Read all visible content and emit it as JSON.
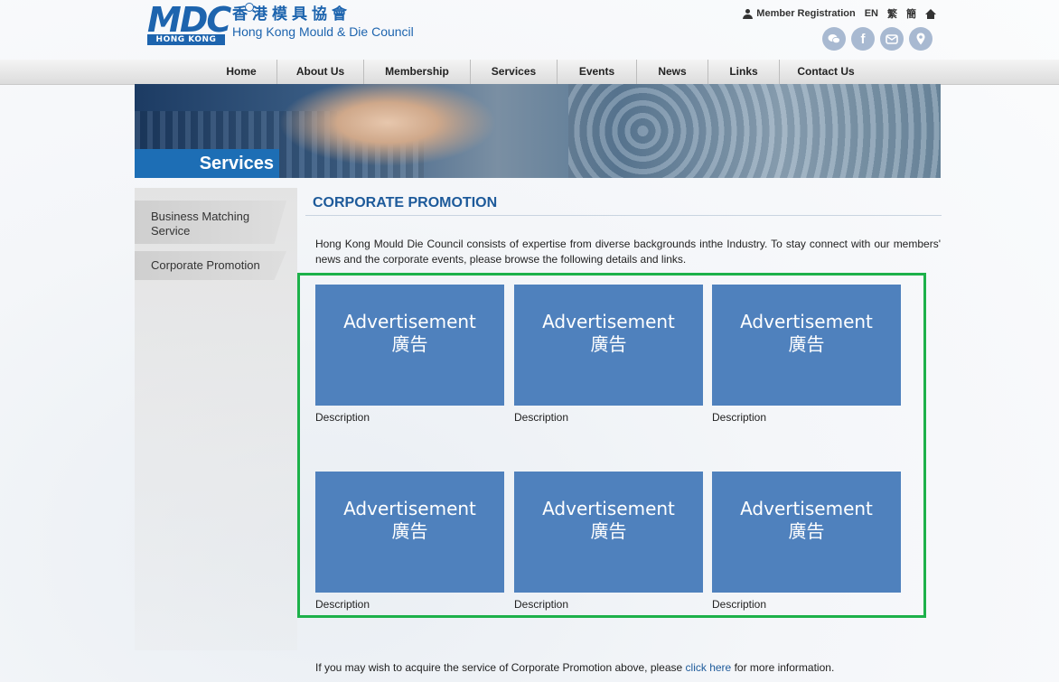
{
  "logo": {
    "letters": "MDC",
    "region": "HONG KONG",
    "name_cn": "香港模具協會",
    "name_en": "Hong Kong Mould & Die Council"
  },
  "topbar": {
    "member_registration": "Member Registration",
    "lang_en": "EN",
    "lang_tc": "繁",
    "lang_sc": "簡"
  },
  "social": [
    "wechat-icon",
    "facebook-icon",
    "email-icon",
    "location-icon"
  ],
  "nav": [
    "Home",
    "About Us",
    "Membership",
    "Services",
    "Events",
    "News",
    "Links",
    "Contact Us"
  ],
  "banner": {
    "label": "Services"
  },
  "sidebar": {
    "items": [
      {
        "label": "Business Matching Service"
      },
      {
        "label": "Corporate Promotion"
      }
    ]
  },
  "main": {
    "title": "CORPORATE PROMOTION",
    "intro": "Hong Kong Mould  Die Council consists of expertise from diverse backgrounds inthe Industry. To stay connect with our members' news and the corporate events, please browse the following details and links.",
    "ads": [
      {
        "title": "Advertisement",
        "subtitle": "廣告",
        "description": "Description"
      },
      {
        "title": "Advertisement",
        "subtitle": "廣告",
        "description": "Description"
      },
      {
        "title": "Advertisement",
        "subtitle": "廣告",
        "description": "Description"
      },
      {
        "title": "Advertisement",
        "subtitle": "廣告",
        "description": "Description"
      },
      {
        "title": "Advertisement",
        "subtitle": "廣告",
        "description": "Description"
      },
      {
        "title": "Advertisement",
        "subtitle": "廣告",
        "description": "Description"
      }
    ]
  },
  "footer": {
    "before": "If you may wish to acquire the service of Corporate Promotion above, please ",
    "link": "click here",
    "after": " for more information."
  }
}
